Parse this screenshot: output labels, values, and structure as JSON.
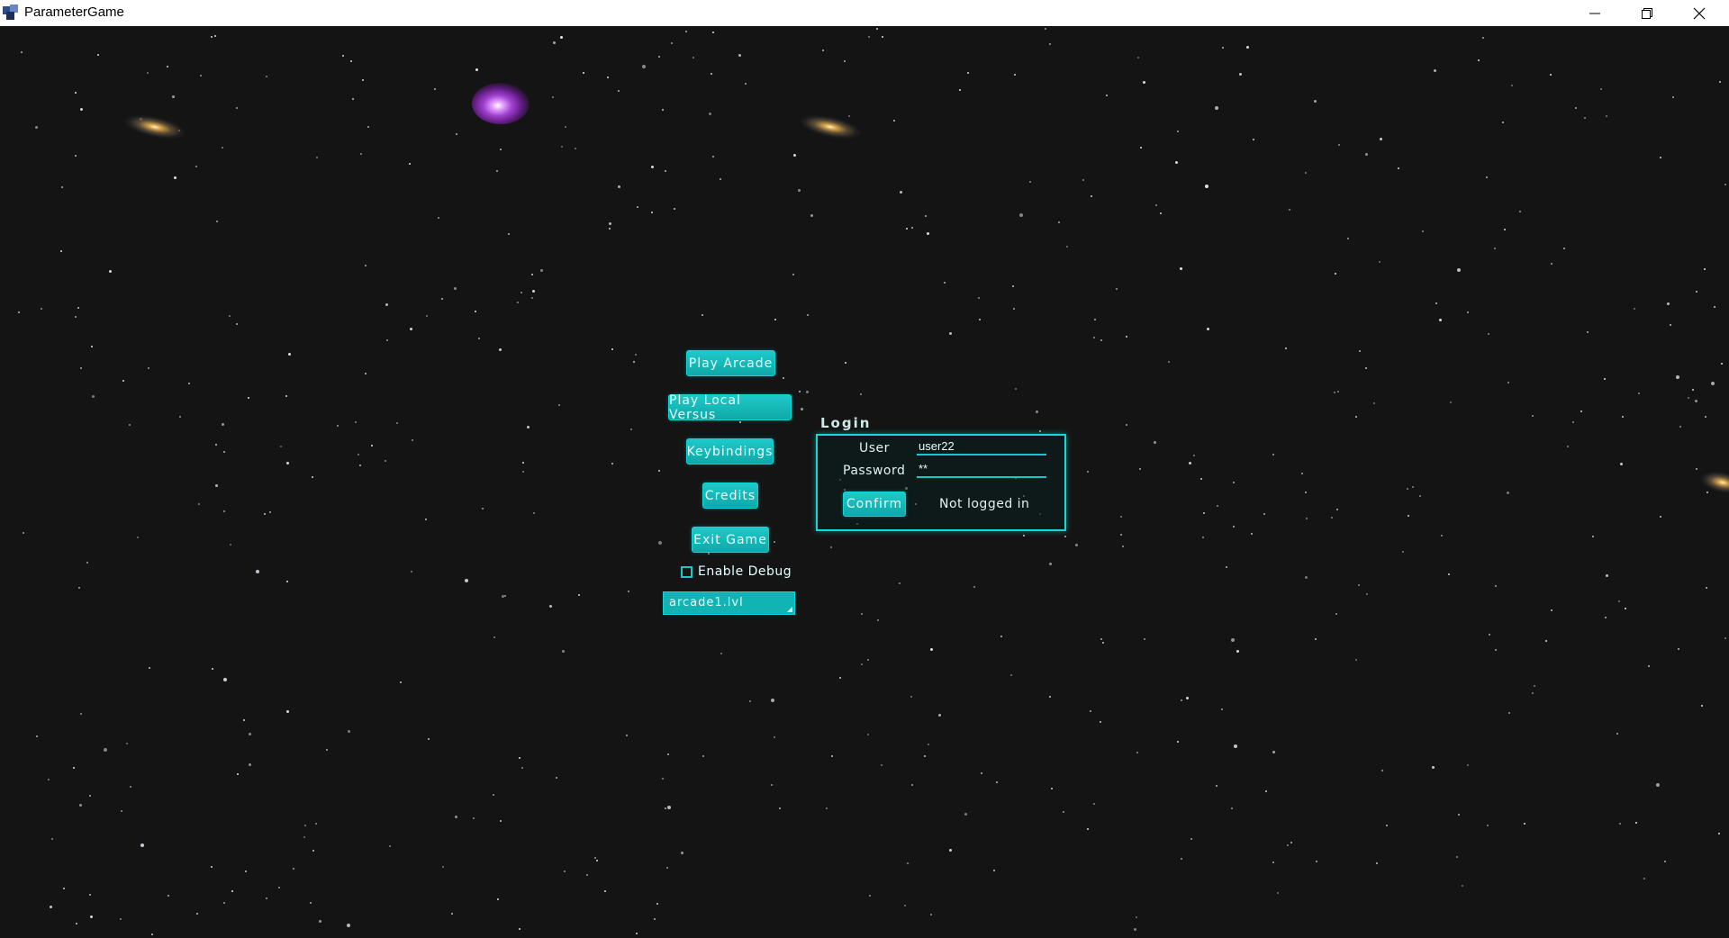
{
  "window": {
    "title": "ParameterGame"
  },
  "menu": {
    "play_arcade": "Play Arcade",
    "play_local_versus": "Play Local Versus",
    "keybindings": "Keybindings",
    "credits": "Credits",
    "exit_game": "Exit Game",
    "enable_debug": "Enable Debug",
    "enable_debug_checked": false,
    "level_selected": "arcade1.lvl"
  },
  "login": {
    "title": "Login",
    "user_label": "User",
    "password_label": "Password",
    "user_value": "user22",
    "password_value": "**",
    "confirm": "Confirm",
    "status": "Not logged in"
  },
  "colors": {
    "background": "#141414",
    "accent": "#12b3b3",
    "accent_border": "#08d8d8",
    "text": "#e8ffff"
  },
  "icons": [
    "app-icon",
    "minimize-icon",
    "restore-icon",
    "close-icon",
    "dropdown-handle-icon"
  ]
}
